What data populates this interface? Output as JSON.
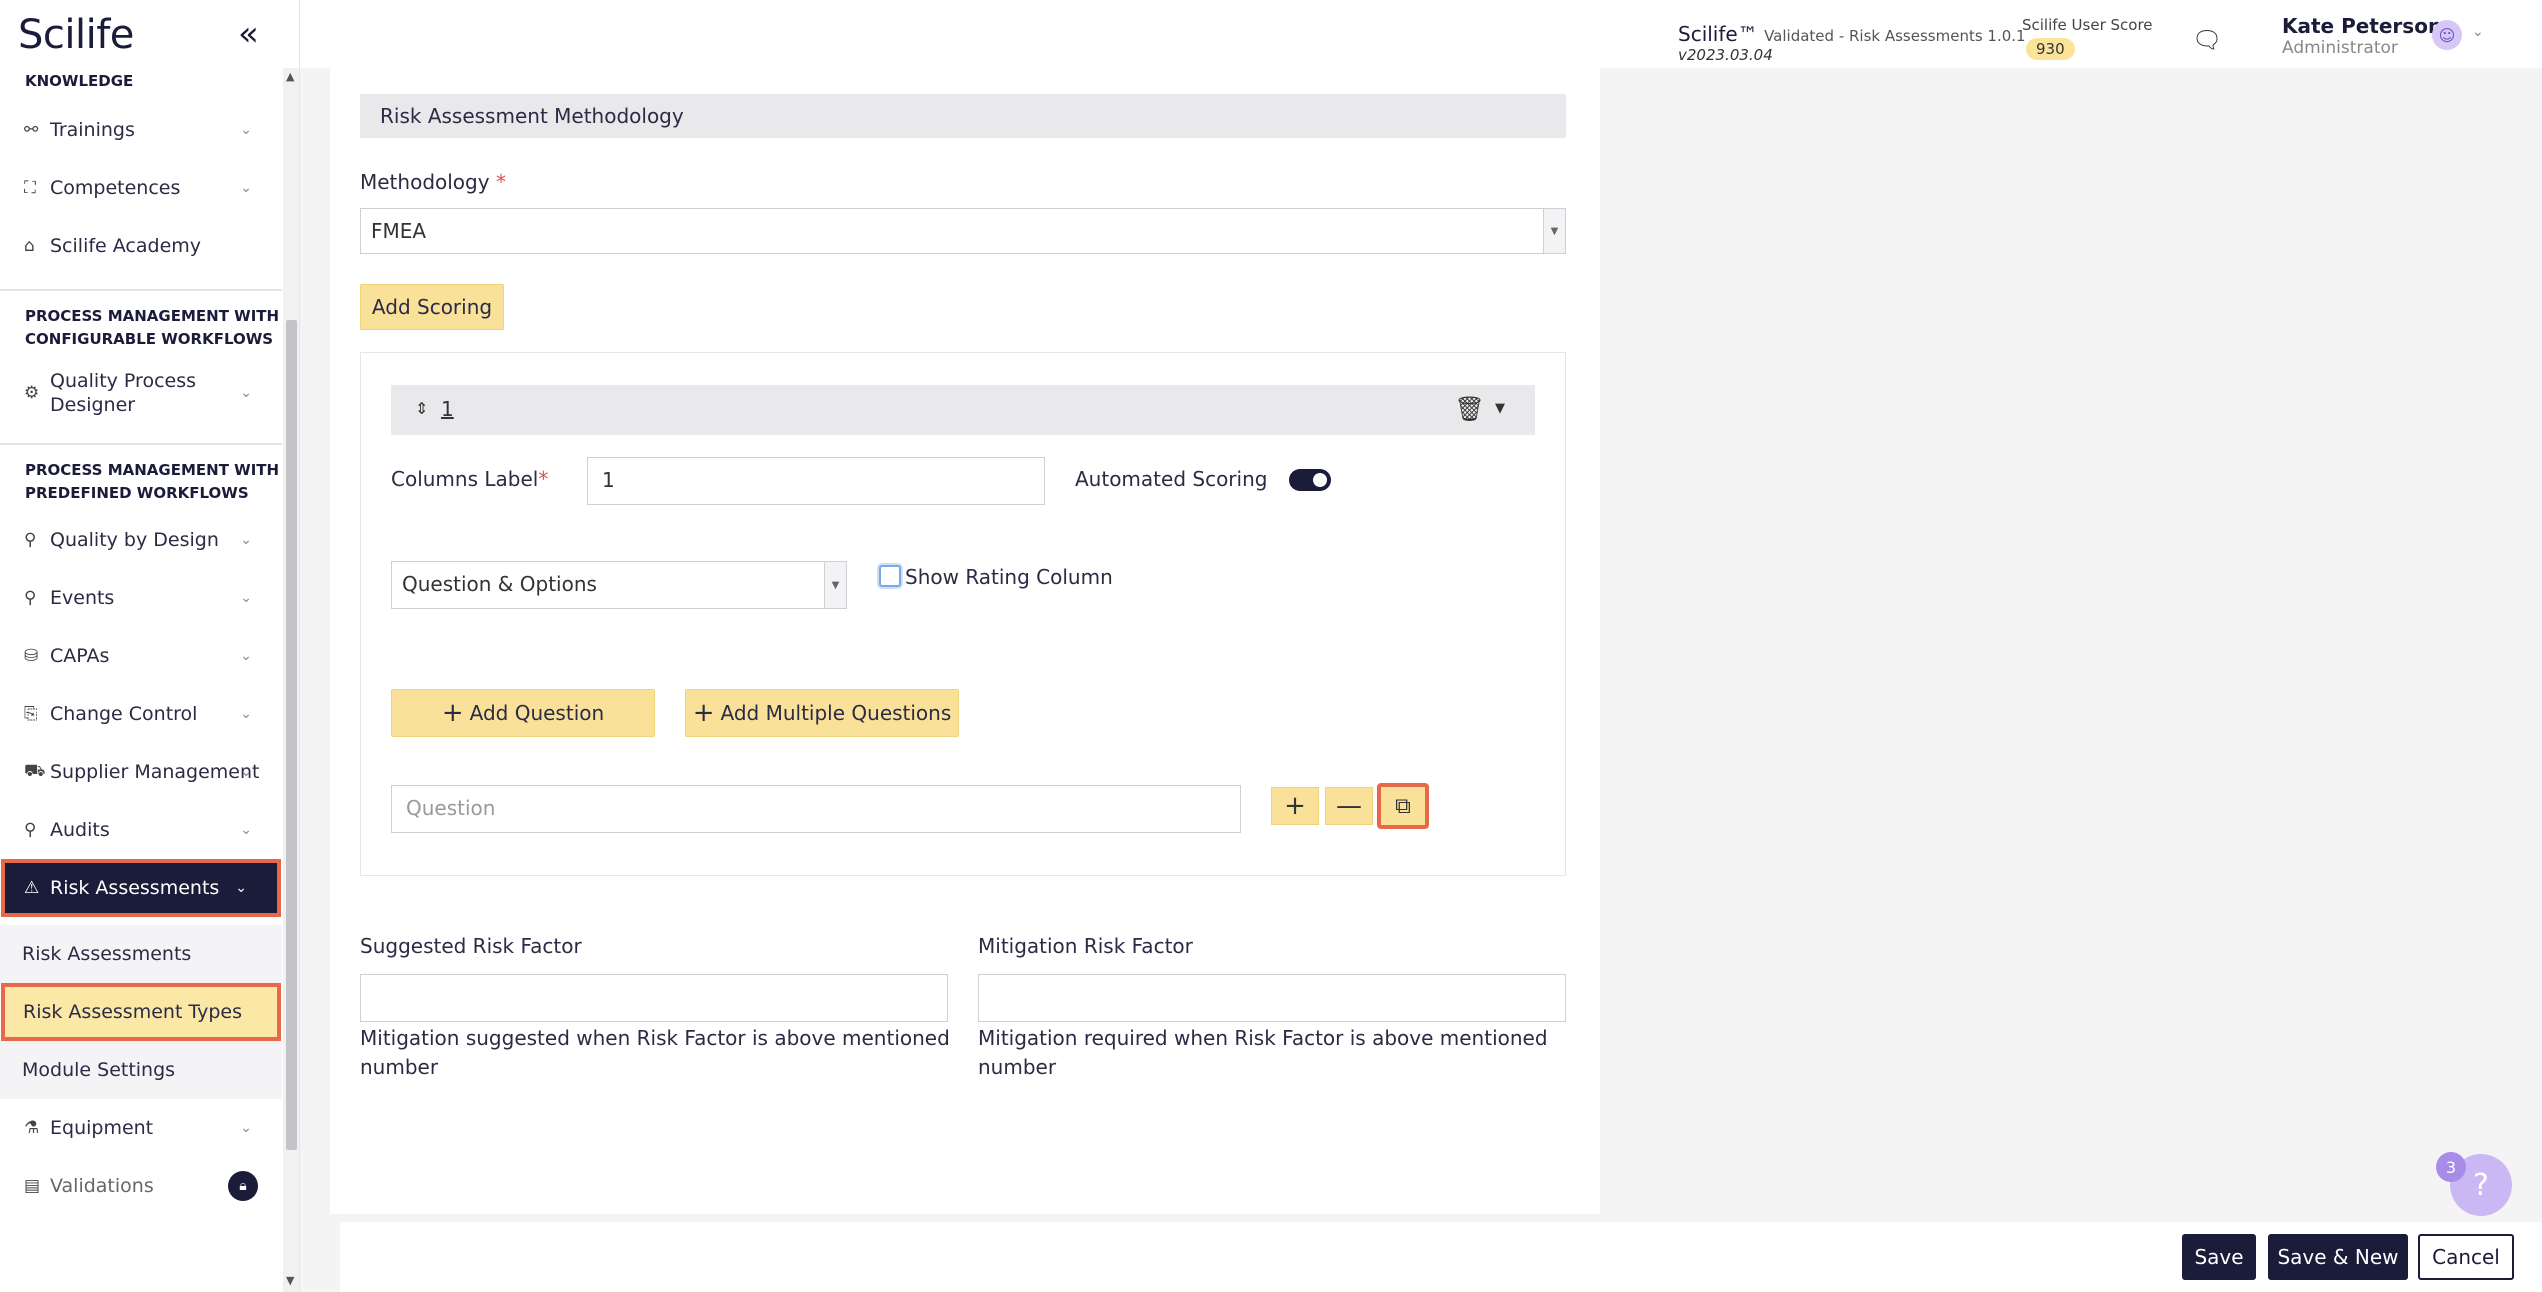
{
  "app": {
    "logo": "Scilife",
    "collapse_icon": "«"
  },
  "header": {
    "product": "Scilife™",
    "product_sub": "Validated - Risk Assessments 1.0.1",
    "version": "v2023.03.04",
    "score_label": "Scilife User Score",
    "score": "930",
    "user_name": "Kate Peterson",
    "user_role": "Administrator"
  },
  "sidebar": {
    "section_knowledge": "KNOWLEDGE",
    "trainings": "Trainings",
    "competences": "Competences",
    "academy": "Scilife Academy",
    "section_configurable_1": "PROCESS MANAGEMENT WITH",
    "section_configurable_2": "CONFIGURABLE WORKFLOWS",
    "qpd_1": "Quality Process",
    "qpd_2": "Designer",
    "section_predefined_1": "PROCESS MANAGEMENT WITH",
    "section_predefined_2": "PREDEFINED WORKFLOWS",
    "qbd": "Quality by Design",
    "events": "Events",
    "capas": "CAPAs",
    "change_control": "Change Control",
    "supplier": "Supplier Management",
    "audits": "Audits",
    "risk": "Risk Assessments",
    "sub_risk": "Risk Assessments",
    "sub_types": "Risk Assessment Types",
    "sub_settings": "Module Settings",
    "equipment": "Equipment",
    "validations": "Validations"
  },
  "form": {
    "section_title": "Risk Assessment Methodology",
    "methodology_label": "Methodology",
    "required_mark": "*",
    "methodology_value": "FMEA",
    "add_scoring": "Add Scoring",
    "scoring_number": "1",
    "columns_label": "Columns Label",
    "columns_value": "1",
    "automated_scoring": "Automated Scoring",
    "question_type": "Question & Options",
    "show_rating": "Show Rating Column",
    "add_question": "Add Question",
    "add_multiple": "Add Multiple Questions",
    "question_placeholder": "Question",
    "suggested_label": "Suggested Risk Factor",
    "mitigation_label": "Mitigation Risk Factor",
    "suggested_help_1": "Mitigation suggested when Risk Factor is above mentioned",
    "suggested_help_2": "number",
    "mitigation_help_1": "Mitigation required when Risk Factor is above mentioned",
    "mitigation_help_2": "number"
  },
  "footer": {
    "save": "Save",
    "save_new": "Save & New",
    "cancel": "Cancel"
  },
  "help": {
    "badge": "3",
    "icon": "?"
  }
}
